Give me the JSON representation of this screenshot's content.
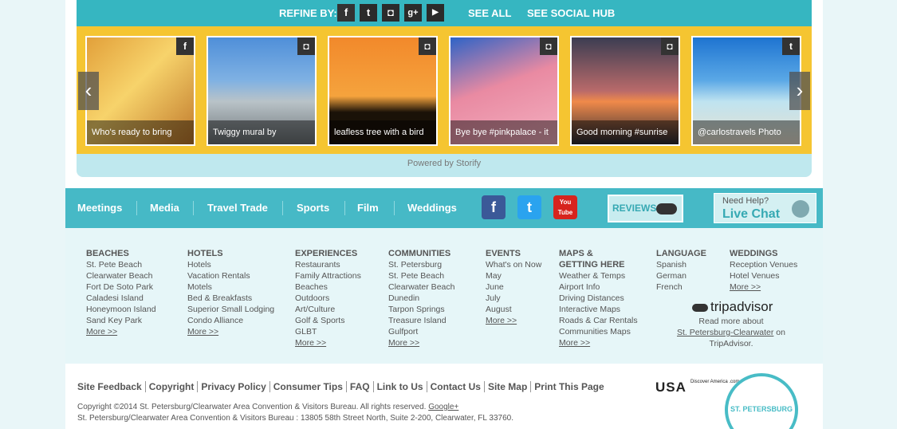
{
  "storify": {
    "refine_label": "REFINE BY:",
    "social_icons": [
      {
        "name": "facebook-icon",
        "glyph": "f"
      },
      {
        "name": "twitter-icon",
        "glyph": "t"
      },
      {
        "name": "instagram-icon",
        "glyph": "◘"
      },
      {
        "name": "google-plus-icon",
        "glyph": "g+"
      },
      {
        "name": "youtube-icon",
        "glyph": "▶"
      }
    ],
    "see_all": "SEE ALL",
    "see_social_hub": "SEE SOCIAL HUB",
    "prev_arrow": "‹",
    "next_arrow": "›",
    "cards": [
      {
        "caption": "Who's ready to bring",
        "badge": "f",
        "source_icon": "facebook-icon",
        "bg": "linear-gradient(135deg,#e2a03a,#f7d36b 45%,#c0792c)"
      },
      {
        "caption": "Twiggy mural by",
        "badge": "◘",
        "source_icon": "instagram-icon",
        "bg": "linear-gradient(180deg,#4f8fd9,#7fb1e3 40%,#b9c3c8 60%,#6d7377)"
      },
      {
        "caption": "leafless tree with a bird",
        "badge": "◘",
        "source_icon": "instagram-icon",
        "bg": "linear-gradient(180deg,#f2892b,#f5a33d 55%,#1a1208 70%)"
      },
      {
        "caption": "Bye bye #pinkpalace - it",
        "badge": "◘",
        "source_icon": "instagram-icon",
        "bg": "linear-gradient(160deg,#2d63c7,#e98aa2 45%,#f3b0c0)"
      },
      {
        "caption": "Good morning #sunrise",
        "badge": "◘",
        "source_icon": "instagram-icon",
        "bg": "linear-gradient(180deg,#3b3d52,#b96a6a 50%,#f08a4a 60%,#2b2a33)"
      },
      {
        "caption": "@carlostravels Photo",
        "badge": "t",
        "source_icon": "twitter-icon",
        "bg": "linear-gradient(180deg,#1e74d1,#5aa8e6 40%,#bfe3f0 60%,#e8e1cf)"
      }
    ],
    "powered_by": "Powered by Storify"
  },
  "nav": {
    "items": [
      "Meetings",
      "Media",
      "Travel Trade",
      "Sports",
      "Film",
      "Weddings"
    ],
    "reviews": "REVIEWS",
    "help_small": "Need Help?",
    "help_big": "Live Chat",
    "social": [
      {
        "name": "facebook-icon",
        "glyph": "f",
        "color": "#3b5998"
      },
      {
        "name": "twitter-icon",
        "glyph": "t",
        "color": "#2aa3ef"
      },
      {
        "name": "youtube-icon",
        "glyph": "You Tube",
        "color": "#d7241e"
      }
    ]
  },
  "sitemap": {
    "columns": [
      {
        "title": [
          "BEACHES"
        ],
        "items": [
          "St. Pete Beach",
          "Clearwater Beach",
          "Fort De Soto Park",
          "Caladesi Island",
          "Honeymoon Island",
          "Sand Key Park"
        ],
        "more": "More >>"
      },
      {
        "title": [
          "HOTELS"
        ],
        "items": [
          "Hotels",
          "Vacation Rentals",
          "Motels",
          "Bed & Breakfasts",
          "Superior Small Lodging",
          "Condo Alliance"
        ],
        "more": "More >>"
      },
      {
        "title": [
          "EXPERIENCES"
        ],
        "items": [
          "Restaurants",
          "Family Attractions",
          "Beaches",
          "Outdoors",
          "Art/Culture",
          "Golf & Sports",
          "GLBT"
        ],
        "more": "More >>"
      },
      {
        "title": [
          "COMMUNITIES"
        ],
        "items": [
          "St. Petersburg",
          "St. Pete Beach",
          "Clearwater Beach",
          "Dunedin",
          "Tarpon Springs",
          "Treasure Island",
          "Gulfport"
        ],
        "more": "More >>"
      },
      {
        "title": [
          "EVENTS"
        ],
        "items": [
          "What's on Now",
          "May",
          "June",
          "July",
          "August"
        ],
        "more": "More >>"
      },
      {
        "title": [
          "MAPS &",
          "GETTING HERE"
        ],
        "items": [
          "Weather & Temps",
          "Airport Info",
          "Driving Distances",
          "Interactive Maps",
          "Roads & Car Rentals",
          "Communities Maps"
        ],
        "more": "More >>"
      },
      {
        "title": [
          "LANGUAGE"
        ],
        "items": [
          "Spanish",
          "German",
          "French"
        ],
        "more": ""
      },
      {
        "title": [
          "WEDDINGS"
        ],
        "items": [
          "Reception Venues",
          "Hotel Venues"
        ],
        "more": "More >>"
      }
    ],
    "tripadvisor": {
      "logo": "tripadvisor",
      "read_more": "Read more about",
      "link": "St. Petersburg-Clearwater",
      "suffix": " on TripAdvisor."
    }
  },
  "footer": {
    "links": [
      "Site Feedback",
      "Copyright",
      "Privacy Policy",
      "Consumer Tips",
      "FAQ",
      "Link to Us",
      "Contact Us",
      "Site Map",
      "Print This Page"
    ],
    "copyright": "Copyright ©2014 St. Petersburg/Clearwater Area Convention & Visitors Bureau. All rights reserved.",
    "google_plus": "Google+",
    "address": "St. Petersburg/Clearwater Area Convention & Visitors Bureau : 13805 58th Street North, Suite 2-200, Clearwater, FL 33760.",
    "usa_logo": "USA",
    "discover": "Discover America .com",
    "seal_text": "ST. PETERSBURG"
  }
}
